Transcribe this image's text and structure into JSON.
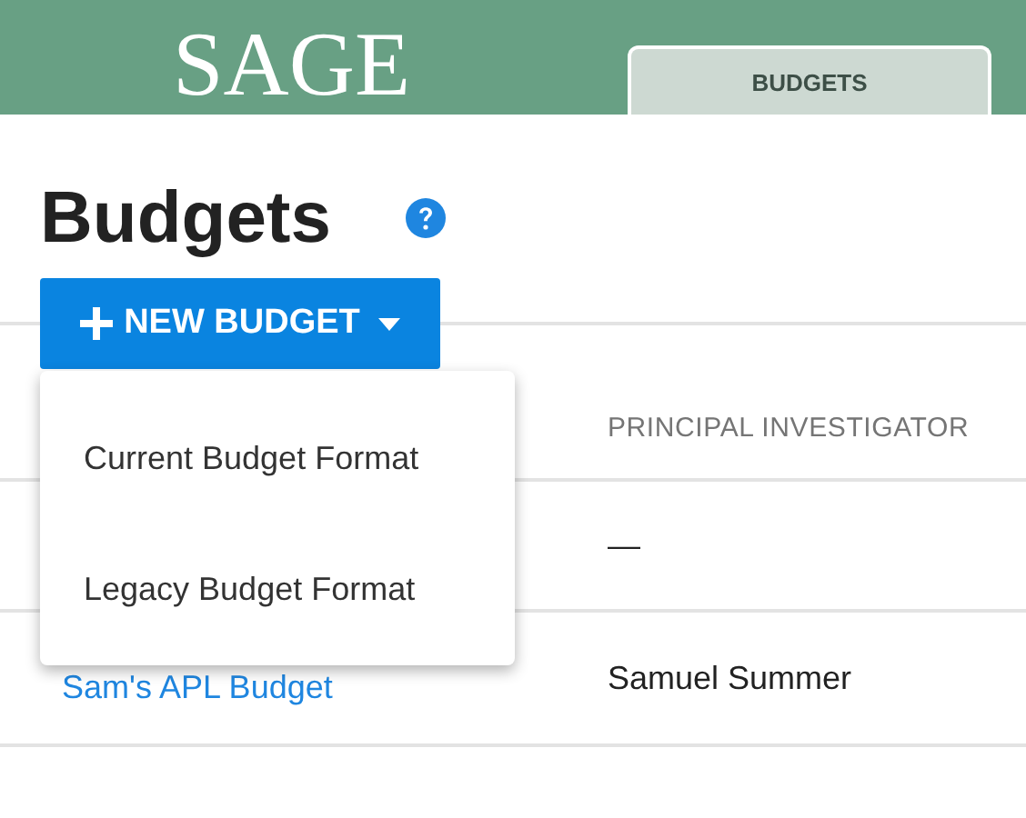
{
  "header": {
    "logo": "SAGE",
    "tabs": [
      {
        "label": "BUDGETS",
        "selected": true
      }
    ]
  },
  "page": {
    "title": "Budgets"
  },
  "new_button": {
    "label": "NEW BUDGET",
    "expanded": true
  },
  "menu": {
    "items": [
      {
        "label": "Current Budget Format"
      },
      {
        "label": "Legacy Budget Format"
      }
    ]
  },
  "table": {
    "columns": [
      {
        "label": "PRINCIPAL INVESTIGATOR"
      }
    ],
    "rows": [
      {
        "investigator": "—"
      },
      {
        "name": "Sam's APL Budget",
        "investigator": "Samuel Summer"
      }
    ]
  }
}
